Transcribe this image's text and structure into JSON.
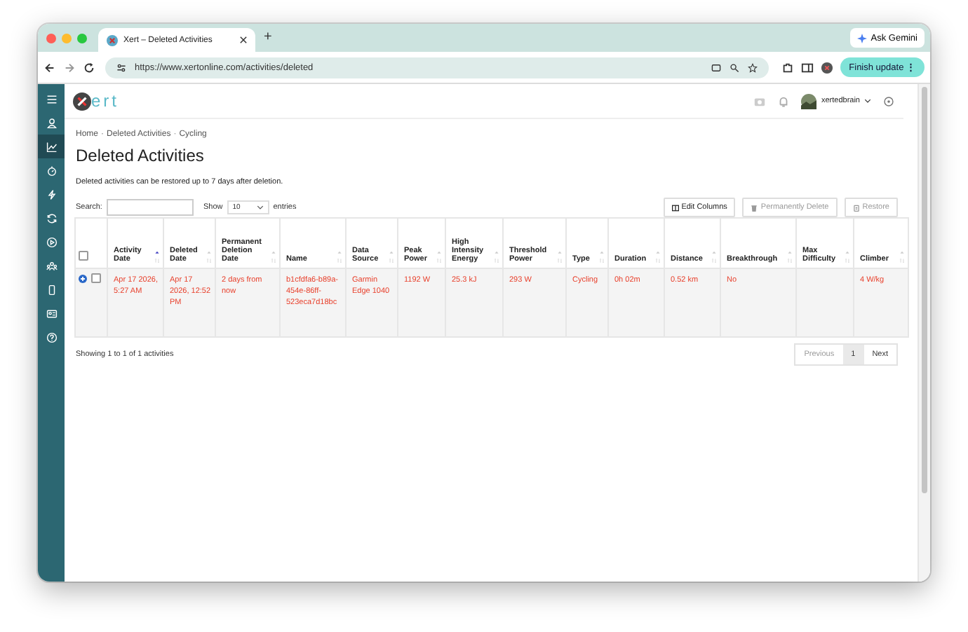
{
  "browser": {
    "tab_title": "Xert – Deleted Activities",
    "new_tab": "+",
    "ask_button": "Ask Gemini",
    "url": "https://www.xertonline.com/activities/deleted",
    "update_button": "Finish update",
    "update_menu": "⋮"
  },
  "sidebar": {
    "items": [
      {
        "kind": "menu",
        "selected": false
      },
      {
        "kind": "person",
        "selected": false
      },
      {
        "kind": "chart",
        "selected": true
      },
      {
        "kind": "stopwatch",
        "selected": false
      },
      {
        "kind": "bolt",
        "selected": false
      },
      {
        "kind": "refresh",
        "selected": false
      },
      {
        "kind": "play",
        "selected": false
      },
      {
        "kind": "group",
        "selected": false
      },
      {
        "kind": "phone",
        "selected": false
      },
      {
        "kind": "card",
        "selected": false
      },
      {
        "kind": "help",
        "selected": false
      }
    ]
  },
  "header": {
    "logo_text": "ert",
    "user": "xertedbrain"
  },
  "breadcrumb": [
    "Home",
    "Deleted Activities",
    "Cycling"
  ],
  "breadcrumb_separator": "·",
  "title": "Deleted Activities",
  "note": "Deleted activities can be restored up to 7 days after deletion.",
  "controls": {
    "search_label": "Search:",
    "show_label": "Show",
    "page_size": "10",
    "entries_label": "entries"
  },
  "actions": [
    {
      "label": "Edit Columns",
      "kind": "columns",
      "disabled": false
    },
    {
      "label": "Permanently Delete",
      "kind": "trash",
      "disabled": true
    },
    {
      "label": "Restore",
      "kind": "restore",
      "disabled": true
    }
  ],
  "table": {
    "select_all_checked": false,
    "columns": [
      {
        "label": "Activity Date",
        "sorted": true
      },
      {
        "label": "Deleted Date",
        "sorted": false
      },
      {
        "label": "Permanent Deletion Date",
        "sorted": false
      },
      {
        "label": "Name",
        "sorted": false
      },
      {
        "label": "Data Source",
        "sorted": false
      },
      {
        "label": "Peak Power",
        "sorted": false
      },
      {
        "label": "High Intensity Energy",
        "sorted": false
      },
      {
        "label": "Threshold Power",
        "sorted": false
      },
      {
        "label": "Type",
        "sorted": false
      },
      {
        "label": "Duration",
        "sorted": false
      },
      {
        "label": "Distance",
        "sorted": false
      },
      {
        "label": "Breakthrough",
        "sorted": false
      },
      {
        "label": "Max Difficulty",
        "sorted": false
      },
      {
        "label": "Climber",
        "sorted": false
      }
    ],
    "rows": [
      {
        "checked": false,
        "cells": [
          "Apr 17 2026, 5:27 AM",
          "Apr 17 2026, 12:52 PM",
          "2 days from now",
          "b1cfdfa6-b89a-454e-86ff-523eca7d18bc",
          "Garmin Edge 1040",
          "1192 W",
          "25.3 kJ",
          "293 W",
          "Cycling",
          "0h 02m",
          "0.52 km",
          "No",
          null,
          "4 W/kg"
        ]
      }
    ]
  },
  "footer": {
    "info": "Showing 1 to 1 of 1 activities",
    "pages": [
      {
        "label": "Previous",
        "selected": false,
        "disabled": true
      },
      {
        "label": "1",
        "selected": true,
        "disabled": false
      },
      {
        "label": "Next",
        "selected": false,
        "disabled": false
      }
    ]
  }
}
